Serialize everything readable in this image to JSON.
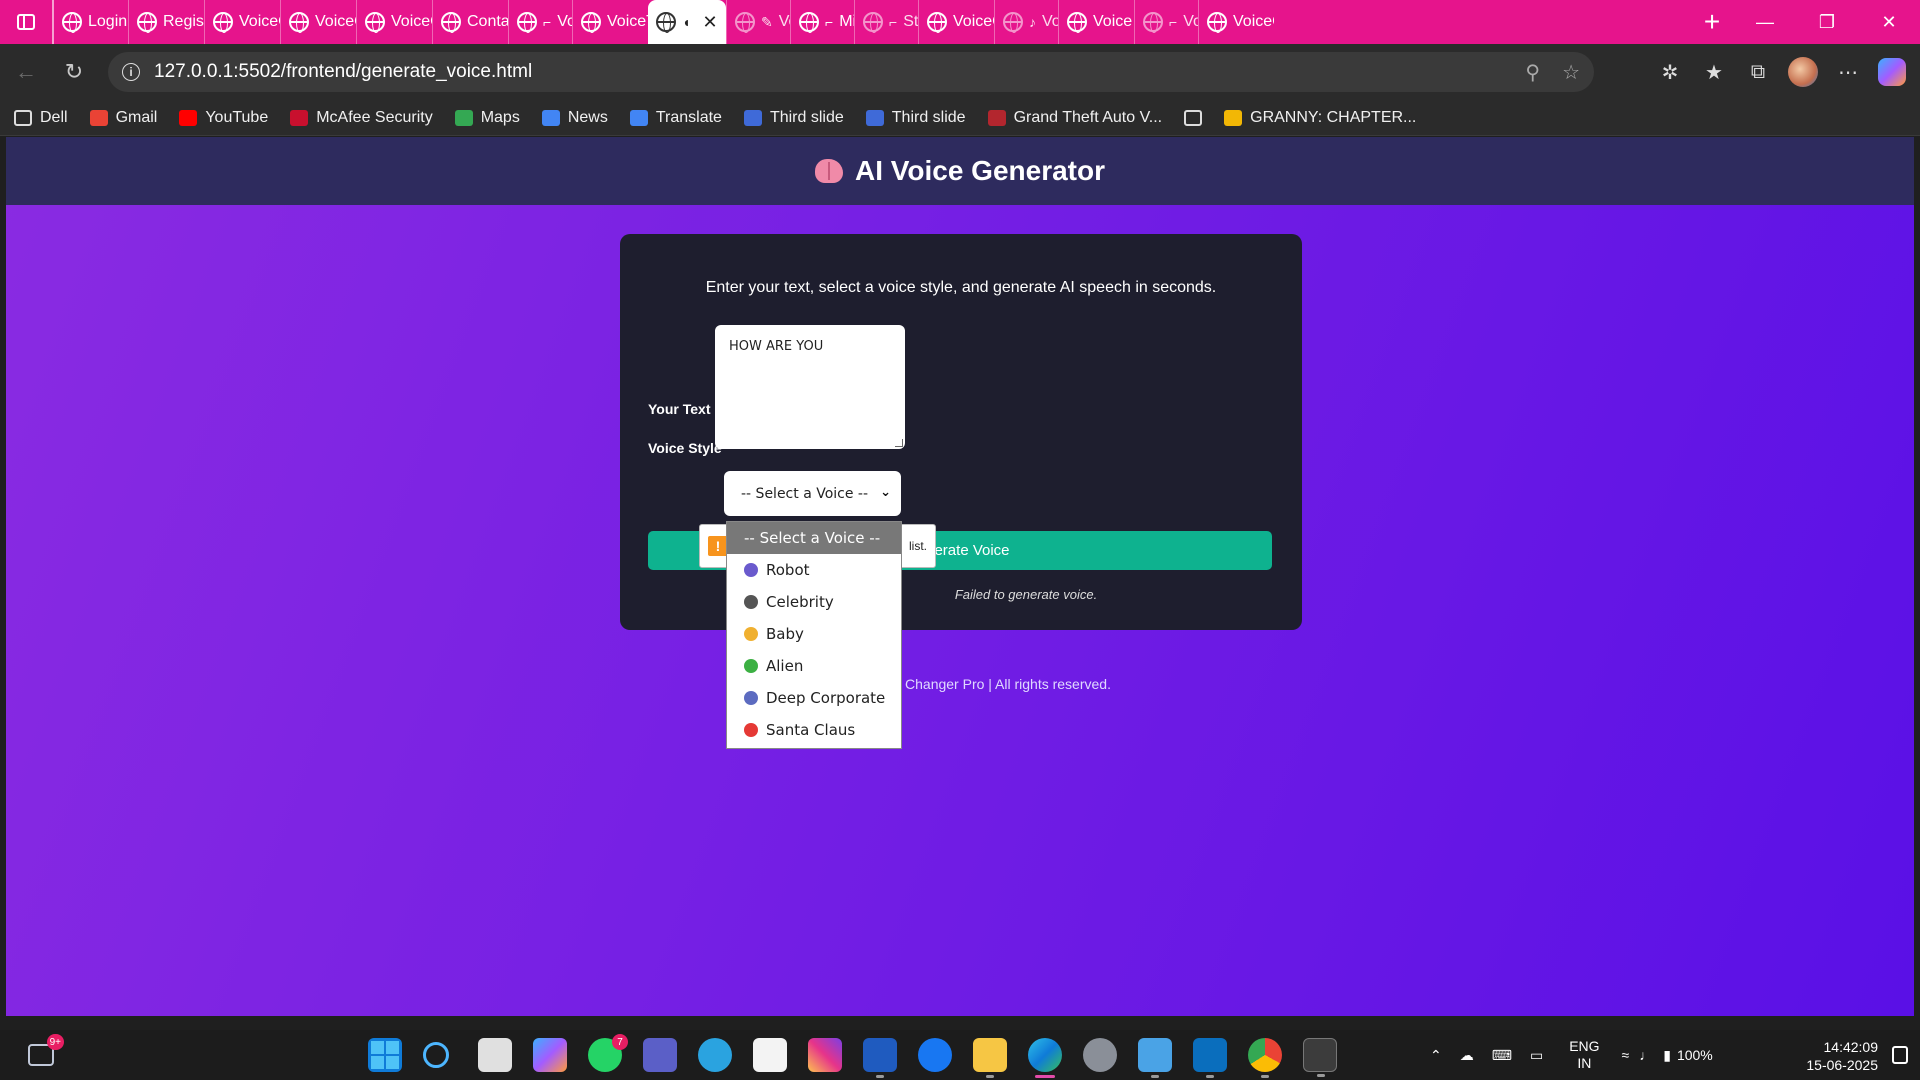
{
  "browser": {
    "tabs": [
      {
        "label": "Login",
        "icon": "globe-icon"
      },
      {
        "label": "Regist",
        "icon": "globe-icon"
      },
      {
        "label": "VoiceC",
        "icon": "globe-icon"
      },
      {
        "label": "VoiceC",
        "icon": "globe-icon"
      },
      {
        "label": "VoiceC",
        "icon": "globe-icon"
      },
      {
        "label": "Conta",
        "icon": "globe-icon"
      },
      {
        "label": "Vo",
        "icon": "headphones-icon"
      },
      {
        "label": "VoiceT",
        "icon": "globe-icon"
      },
      {
        "label": "",
        "icon": "brain-icon",
        "active": true
      },
      {
        "label": "Vo",
        "icon": "microphone-icon"
      },
      {
        "label": "Mi",
        "icon": "headphones-icon"
      },
      {
        "label": "Stu",
        "icon": "headphones-icon"
      },
      {
        "label": "VoiceC",
        "icon": "globe-icon"
      },
      {
        "label": "Vo",
        "icon": "music-note-icon"
      },
      {
        "label": "Voice",
        "icon": "globe-icon"
      },
      {
        "label": "Vo",
        "icon": "headphones-icon"
      },
      {
        "label": "VoiceC",
        "icon": "globe-icon"
      }
    ],
    "url": "127.0.0.1:5502/frontend/generate_voice.html",
    "bookmarks": [
      {
        "label": "Dell",
        "color": "#2b2b2b"
      },
      {
        "label": "Gmail",
        "color": "#ea4335"
      },
      {
        "label": "YouTube",
        "color": "#ff0000"
      },
      {
        "label": "McAfee Security",
        "color": "#c8102e"
      },
      {
        "label": "Maps",
        "color": "#34a853"
      },
      {
        "label": "News",
        "color": "#4285f4"
      },
      {
        "label": "Translate",
        "color": "#4285f4"
      },
      {
        "label": "Third slide",
        "color": "#3f6ad8"
      },
      {
        "label": "Third slide",
        "color": "#3f6ad8"
      },
      {
        "label": "Grand Theft Auto V...",
        "color": "#b3262e"
      },
      {
        "label": "",
        "color": "#2b2b2b"
      },
      {
        "label": "GRANNY: CHAPTER...",
        "color": "#f2b705"
      }
    ]
  },
  "app": {
    "title": "AI Voice Generator",
    "intro": "Enter your text, select a voice style, and generate AI speech in seconds.",
    "text_label": "Your Text",
    "text_value": "HOW ARE YOU",
    "voice_label": "Voice Style",
    "voice_selected": "-- Select a Voice --",
    "generate_label": "erate Voice",
    "error_text": "Failed to generate voice.",
    "footer_text": "Changer Pro | All rights reserved.",
    "tooltip_text": "list.",
    "voice_options": [
      {
        "label": "-- Select a Voice --",
        "color": "#787878"
      },
      {
        "label": "Robot",
        "color": "#6a5acd"
      },
      {
        "label": "Celebrity",
        "color": "#555555"
      },
      {
        "label": "Baby",
        "color": "#f0b030"
      },
      {
        "label": "Alien",
        "color": "#3cb043"
      },
      {
        "label": "Deep Corporate",
        "color": "#5c6bc0"
      },
      {
        "label": "Santa Claus",
        "color": "#e53935"
      }
    ]
  },
  "taskbar": {
    "widget_badge": "9+",
    "whatsapp_badge": "7",
    "lang_top": "ENG",
    "lang_bottom": "IN",
    "battery": "100%",
    "time": "14:42:09",
    "date": "15-06-2025"
  }
}
